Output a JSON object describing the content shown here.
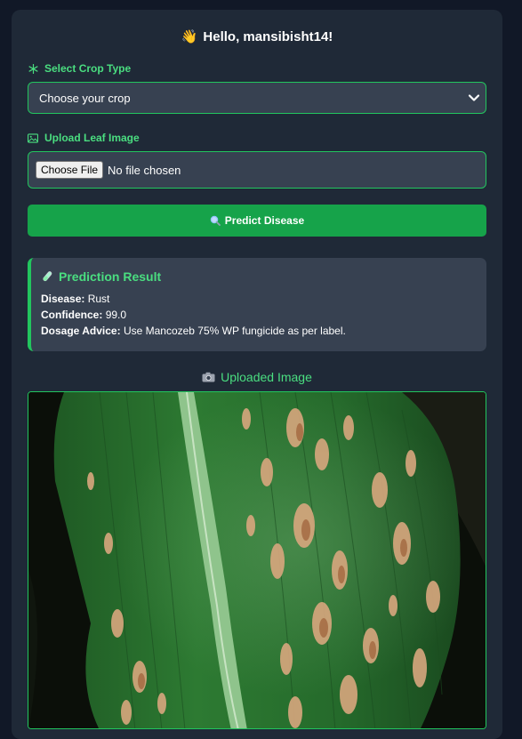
{
  "greeting": {
    "emoji": "👋",
    "text": "Hello, mansibisht14!"
  },
  "crop": {
    "label": "Select Crop Type",
    "icon": "snowflake-icon",
    "selected": "Choose your crop"
  },
  "upload": {
    "label": "Upload Leaf Image",
    "icon": "image-icon",
    "button": "Choose File",
    "status": "No file chosen"
  },
  "predict_button": {
    "icon": "magnifier-icon",
    "label": "Predict Disease"
  },
  "result": {
    "icon": "test-tube-icon",
    "title": "Prediction Result",
    "disease_label": "Disease:",
    "disease": "Rust",
    "confidence_label": "Confidence:",
    "confidence": "99.0",
    "dosage_label": "Dosage Advice:",
    "dosage": "Use Mancozeb 75% WP fungicide as per label."
  },
  "uploaded": {
    "icon": "camera-icon",
    "title": "Uploaded Image"
  },
  "colors": {
    "accent": "#4ade80",
    "button": "#16a34a",
    "card": "#1f2937",
    "background": "#111827"
  }
}
